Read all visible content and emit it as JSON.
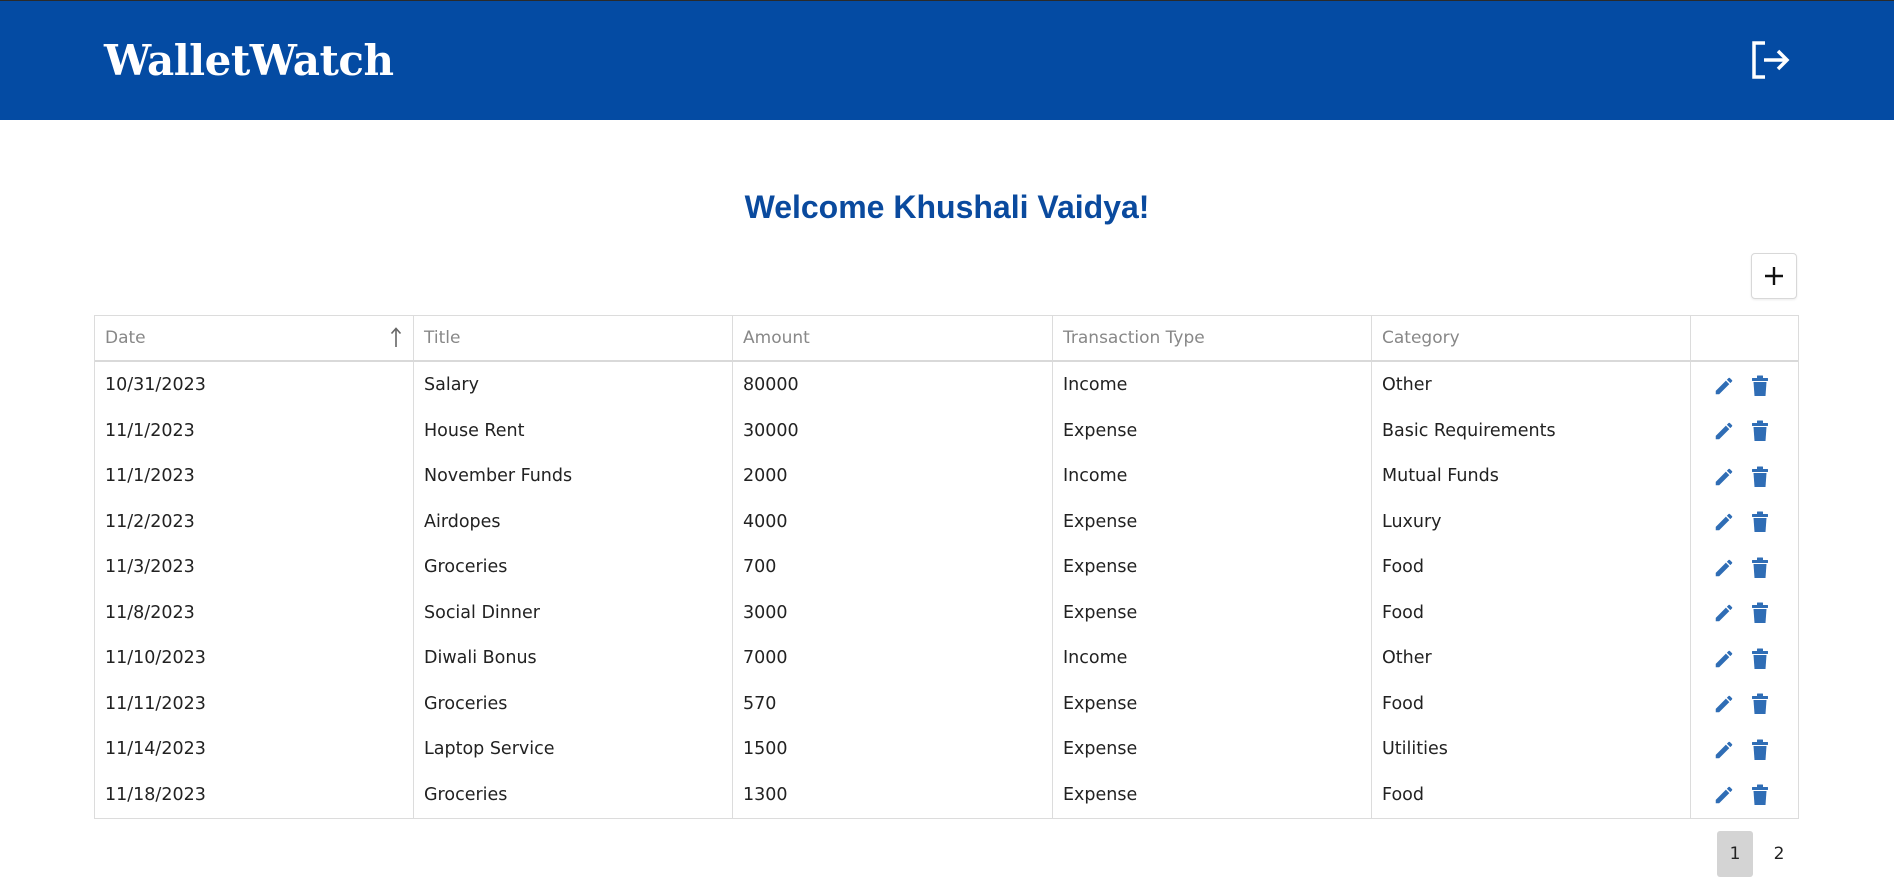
{
  "app": {
    "brand": "WalletWatch",
    "logout_icon": "logout-icon"
  },
  "welcome": "Welcome Khushali Vaidya!",
  "toolbar": {
    "add_icon": "plus-icon"
  },
  "colors": {
    "header_bg": "#044ba3",
    "accent": "#0a4a9e",
    "action_icon": "#2f6db5"
  },
  "table": {
    "headers": [
      "Date",
      "Title",
      "Amount",
      "Transaction Type",
      "Category"
    ],
    "sort_column": "Date",
    "sort_icon": "arrow-up-icon",
    "rows": [
      {
        "date": "10/31/2023",
        "title": "Salary",
        "amount": "80000",
        "type": "Income",
        "category": "Other"
      },
      {
        "date": "11/1/2023",
        "title": "House Rent",
        "amount": "30000",
        "type": "Expense",
        "category": "Basic Requirements"
      },
      {
        "date": "11/1/2023",
        "title": "November Funds",
        "amount": "2000",
        "type": "Income",
        "category": "Mutual Funds"
      },
      {
        "date": "11/2/2023",
        "title": "Airdopes",
        "amount": "4000",
        "type": "Expense",
        "category": "Luxury"
      },
      {
        "date": "11/3/2023",
        "title": "Groceries",
        "amount": "700",
        "type": "Expense",
        "category": "Food"
      },
      {
        "date": "11/8/2023",
        "title": "Social Dinner",
        "amount": "3000",
        "type": "Expense",
        "category": "Food"
      },
      {
        "date": "11/10/2023",
        "title": "Diwali Bonus",
        "amount": "7000",
        "type": "Income",
        "category": "Other"
      },
      {
        "date": "11/11/2023",
        "title": "Groceries",
        "amount": "570",
        "type": "Expense",
        "category": "Food"
      },
      {
        "date": "11/14/2023",
        "title": "Laptop Service",
        "amount": "1500",
        "type": "Expense",
        "category": "Utilities"
      },
      {
        "date": "11/18/2023",
        "title": "Groceries",
        "amount": "1300",
        "type": "Expense",
        "category": "Food"
      }
    ]
  },
  "pagination": {
    "pages": [
      "1",
      "2"
    ],
    "current": "1"
  }
}
